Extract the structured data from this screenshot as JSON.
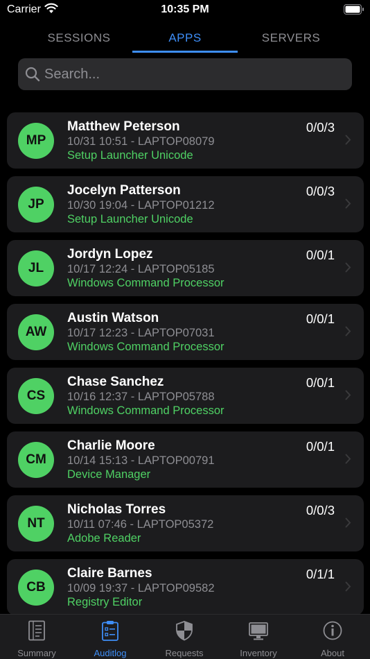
{
  "status_bar": {
    "carrier": "Carrier",
    "time": "10:35 PM"
  },
  "tabs": [
    {
      "label": "SESSIONS",
      "active": false
    },
    {
      "label": "APPS",
      "active": true
    },
    {
      "label": "SERVERS",
      "active": false
    }
  ],
  "search": {
    "placeholder": "Search..."
  },
  "entries": [
    {
      "initials": "MP",
      "name": "Matthew Peterson",
      "meta": "10/31 10:51 - LAPTOP08079",
      "app": "Setup Launcher Unicode",
      "count": "0/0/3"
    },
    {
      "initials": "JP",
      "name": "Jocelyn Patterson",
      "meta": "10/30 19:04 - LAPTOP01212",
      "app": "Setup Launcher Unicode",
      "count": "0/0/3"
    },
    {
      "initials": "JL",
      "name": "Jordyn Lopez",
      "meta": "10/17 12:24 - LAPTOP05185",
      "app": "Windows Command Processor",
      "count": "0/0/1"
    },
    {
      "initials": "AW",
      "name": "Austin Watson",
      "meta": "10/17 12:23 - LAPTOP07031",
      "app": "Windows Command Processor",
      "count": "0/0/1"
    },
    {
      "initials": "CS",
      "name": "Chase Sanchez",
      "meta": "10/16 12:37 - LAPTOP05788",
      "app": "Windows Command Processor",
      "count": "0/0/1"
    },
    {
      "initials": "CM",
      "name": "Charlie Moore",
      "meta": "10/14 15:13 - LAPTOP00791",
      "app": "Device Manager",
      "count": "0/0/1"
    },
    {
      "initials": "NT",
      "name": "Nicholas Torres",
      "meta": "10/11 07:46 - LAPTOP05372",
      "app": "Adobe Reader",
      "count": "0/0/3"
    },
    {
      "initials": "CB",
      "name": "Claire Barnes",
      "meta": "10/09 19:37 - LAPTOP09582",
      "app": "Registry Editor",
      "count": "0/1/1"
    }
  ],
  "tabbar": [
    {
      "label": "Summary",
      "icon": "summary-icon",
      "active": false
    },
    {
      "label": "Auditlog",
      "icon": "clipboard-icon",
      "active": true
    },
    {
      "label": "Requests",
      "icon": "shield-icon",
      "active": false
    },
    {
      "label": "Inventory",
      "icon": "monitor-icon",
      "active": false
    },
    {
      "label": "About",
      "icon": "info-icon",
      "active": false
    }
  ],
  "colors": {
    "accent": "#3e8ef7",
    "avatar": "#4fd164",
    "app_text": "#4fd164",
    "card": "#1c1c1e",
    "background": "#000000"
  }
}
